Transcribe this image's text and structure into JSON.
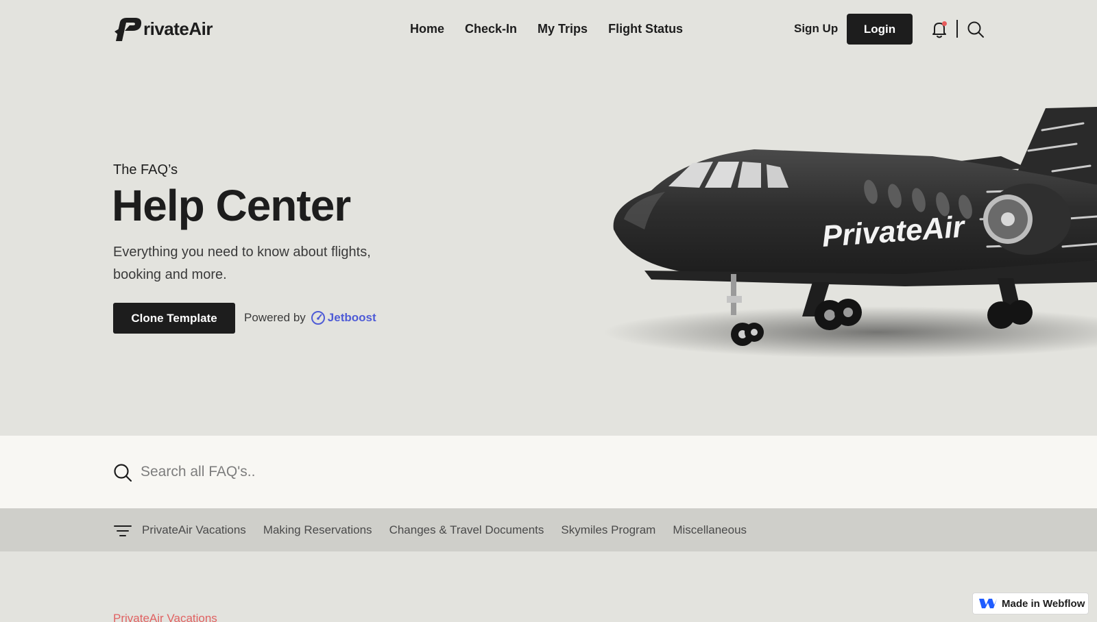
{
  "brand": {
    "name": "rivateAir",
    "accent": "#1d1d1d",
    "link_accent": "#4e5bd6",
    "highlight": "#e06262"
  },
  "nav": {
    "links": [
      "Home",
      "Check-In",
      "My Trips",
      "Flight Status"
    ],
    "signup": "Sign Up",
    "login": "Login",
    "icons": [
      "bell-icon",
      "search-icon"
    ]
  },
  "hero": {
    "eyebrow": "The FAQ’s",
    "title": "Help Center",
    "subtitle": "Everything you need to know about flights, booking and more.",
    "cta": "Clone Template",
    "powered_by": "Powered by",
    "powered_brand": "Jetboost",
    "plane_livery": "PrivateAir"
  },
  "search": {
    "placeholder": "Search all FAQ's..",
    "value": ""
  },
  "categories": [
    "PrivateAir Vacations",
    "Making Reservations",
    "Changes & Travel Documents",
    "Skymiles Program",
    "Miscellaneous"
  ],
  "section": {
    "label": "PrivateAir Vacations"
  },
  "badge": {
    "label": "Made in Webflow"
  }
}
